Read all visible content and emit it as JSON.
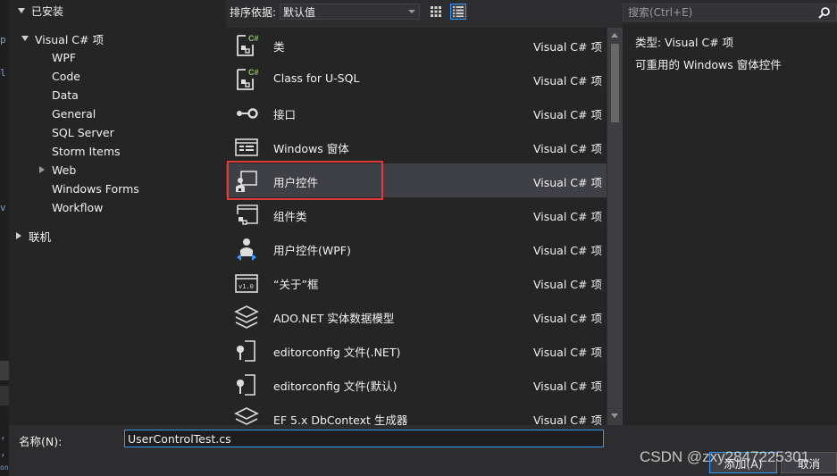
{
  "side_fragments": [
    "p",
    "l",
    "v",
    ",",
    ",",
    "on"
  ],
  "tree": {
    "installed": "已安装",
    "root": "Visual C# 项",
    "children": [
      "WPF",
      "Code",
      "Data",
      "General",
      "SQL Server",
      "Storm Items",
      "Web",
      "Windows Forms",
      "Workflow"
    ],
    "online": "联机"
  },
  "toolbar": {
    "sort_label": "排序依据:",
    "sort_value": "默认值"
  },
  "search": {
    "placeholder": "搜索(Ctrl+E)"
  },
  "templates": [
    {
      "name": "类",
      "lang": "Visual C# 项",
      "icon": "class-icon"
    },
    {
      "name": "Class for U-SQL",
      "lang": "Visual C# 项",
      "icon": "class-usql-icon"
    },
    {
      "name": "接口",
      "lang": "Visual C# 项",
      "icon": "interface-icon"
    },
    {
      "name": "Windows 窗体",
      "lang": "Visual C# 项",
      "icon": "windows-form-icon"
    },
    {
      "name": "用户控件",
      "lang": "Visual C# 项",
      "icon": "user-control-icon",
      "selected": true
    },
    {
      "name": "组件类",
      "lang": "Visual C# 项",
      "icon": "component-class-icon"
    },
    {
      "name": "用户控件(WPF)",
      "lang": "Visual C# 项",
      "icon": "wpf-user-control-icon"
    },
    {
      "name": "“关于”框",
      "lang": "Visual C# 项",
      "icon": "about-box-icon"
    },
    {
      "name": "ADO.NET 实体数据模型",
      "lang": "Visual C# 项",
      "icon": "ado-model-icon"
    },
    {
      "name": "editorconfig 文件(.NET)",
      "lang": "Visual C# 项",
      "icon": "editorconfig-icon"
    },
    {
      "name": "editorconfig 文件(默认)",
      "lang": "Visual C# 项",
      "icon": "editorconfig-icon"
    },
    {
      "name": "EF 5.x DbContext 生成器",
      "lang": "Visual C# 项",
      "icon": "ef-generator-icon"
    }
  ],
  "details": {
    "type_line": "类型:  Visual C# 项",
    "description": "可重用的 Windows 窗体控件"
  },
  "bottom": {
    "name_label": "名称(N):",
    "name_value": "UserControlTest.cs",
    "add_label": "添加(A)",
    "cancel_label": "取消"
  },
  "watermark": "CSDN @zxy2847225301",
  "colors": {
    "accent": "#3399ff",
    "highlight": "#e03a3a",
    "background": "#252526"
  }
}
